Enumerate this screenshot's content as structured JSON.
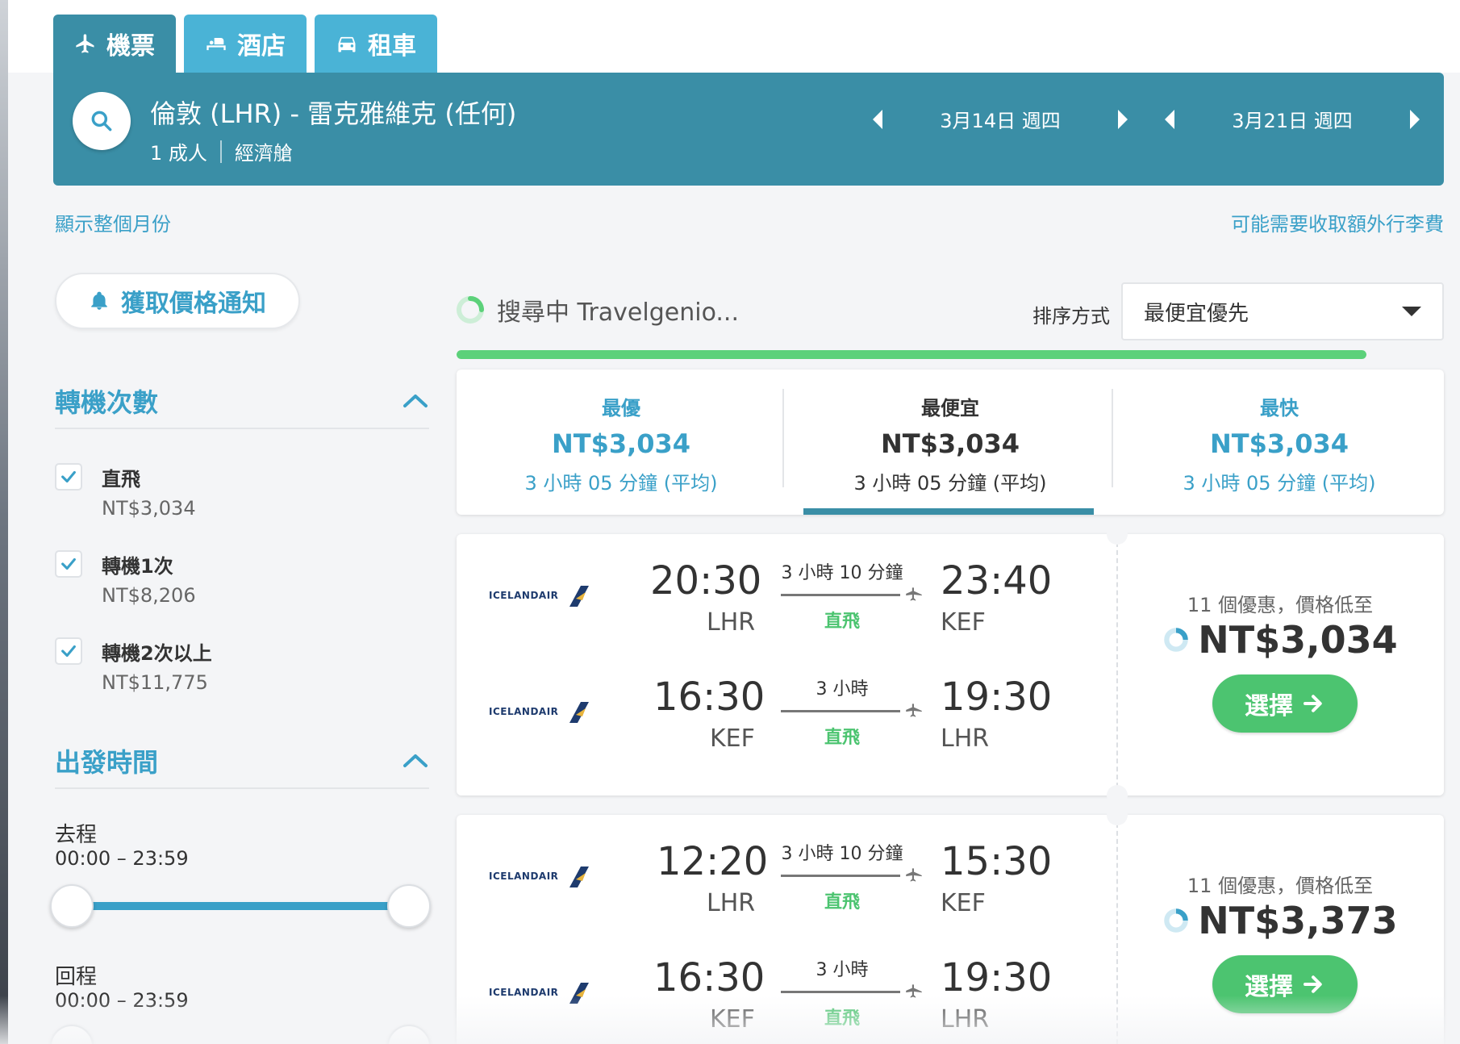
{
  "tabs": [
    {
      "label": "機票",
      "icon": "plane-icon",
      "active": true
    },
    {
      "label": "酒店",
      "icon": "bed-icon",
      "active": false
    },
    {
      "label": "租車",
      "icon": "car-icon",
      "active": false
    }
  ],
  "search": {
    "route": "倫敦 (LHR) - 雷克雅維克 (任何)",
    "passengers": "1 成人",
    "cabin": "經濟艙",
    "depart_date": "3月14日 週四",
    "return_date": "3月21日 週四"
  },
  "links": {
    "show_month": "顯示整個月份",
    "baggage_fee": "可能需要收取額外行李費"
  },
  "price_alert": {
    "label": "獲取價格通知"
  },
  "filters": {
    "stops": {
      "title": "轉機次數",
      "options": [
        {
          "label": "直飛",
          "price": "NT$3,034",
          "checked": true
        },
        {
          "label": "轉機1次",
          "price": "NT$8,206",
          "checked": true
        },
        {
          "label": "轉機2次以上",
          "price": "NT$11,775",
          "checked": true
        }
      ]
    },
    "departure_time": {
      "title": "出發時間",
      "outbound_label": "去程",
      "outbound_range": "00:00 – 23:59",
      "return_label": "回程",
      "return_range": "00:00 – 23:59"
    }
  },
  "status": {
    "text": "搜尋中 Travelgenio...",
    "progress": 1.0
  },
  "sort": {
    "label": "排序方式",
    "selected": "最便宜優先"
  },
  "summary": [
    {
      "title": "最優",
      "price": "NT$3,034",
      "duration": "3 小時 05 分鐘 (平均)",
      "style": "blue"
    },
    {
      "title": "最便宜",
      "price": "NT$3,034",
      "duration": "3 小時 05 分鐘 (平均)",
      "style": "dark",
      "selected": true
    },
    {
      "title": "最快",
      "price": "NT$3,034",
      "duration": "3 小時 05 分鐘 (平均)",
      "style": "blue"
    }
  ],
  "results": [
    {
      "legs": [
        {
          "airline": "ICELANDAIR",
          "dep_time": "20:30",
          "dep_code": "LHR",
          "duration": "3 小時 10 分鐘",
          "stops": "直飛",
          "arr_time": "23:40",
          "arr_code": "KEF"
        },
        {
          "airline": "ICELANDAIR",
          "dep_time": "16:30",
          "dep_code": "KEF",
          "duration": "3 小時",
          "stops": "直飛",
          "arr_time": "19:30",
          "arr_code": "LHR"
        }
      ],
      "offers": "11 個優惠，價格低至",
      "price": "NT$3,034",
      "button": "選擇"
    },
    {
      "legs": [
        {
          "airline": "ICELANDAIR",
          "dep_time": "12:20",
          "dep_code": "LHR",
          "duration": "3 小時 10 分鐘",
          "stops": "直飛",
          "arr_time": "15:30",
          "arr_code": "KEF"
        },
        {
          "airline": "ICELANDAIR",
          "dep_time": "16:30",
          "dep_code": "KEF",
          "duration": "3 小時",
          "stops": "直飛",
          "arr_time": "19:30",
          "arr_code": "LHR"
        }
      ],
      "offers": "11 個優惠，價格低至",
      "price": "NT$3,373",
      "button": "選擇"
    }
  ],
  "colors": {
    "primary": "#3a8ea6",
    "accent": "#3aa0c8",
    "success": "#4cc470",
    "progress": "#5cd17a"
  }
}
